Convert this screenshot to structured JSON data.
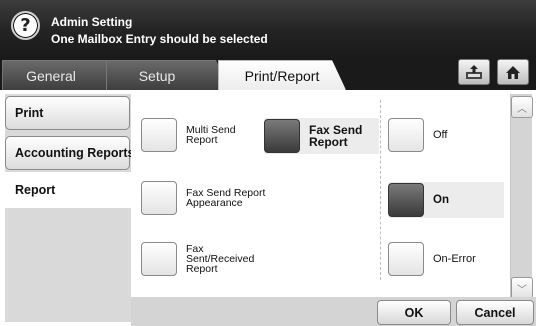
{
  "header": {
    "help_glyph": "?",
    "title": "Admin Setting",
    "message": "One Mailbox Entry should be selected"
  },
  "tabs": [
    {
      "label": "General",
      "active": false
    },
    {
      "label": "Setup",
      "active": false
    },
    {
      "label": "Print/Report",
      "active": true
    }
  ],
  "toolbar": {
    "tray_icon": "tray-upload-icon",
    "home_icon": "home-icon"
  },
  "sidebar": {
    "items": [
      {
        "label": "Print"
      },
      {
        "label": "Accounting Reports"
      },
      {
        "label": "Report",
        "selected": true
      }
    ]
  },
  "report_types": [
    {
      "label": "Multi Send Report",
      "selected": false
    },
    {
      "label": "Fax Send Report Appearance",
      "selected": false
    },
    {
      "label": "Fax Sent/Received Report",
      "selected": false
    },
    {
      "label": "Fax Send Report",
      "selected": true
    }
  ],
  "modes": [
    {
      "label": "Off",
      "selected": false
    },
    {
      "label": "On",
      "selected": true
    },
    {
      "label": "On-Error",
      "selected": false
    }
  ],
  "scroll": {
    "up_glyph": "︿",
    "down_glyph": "﹀"
  },
  "actions": {
    "ok_label": "OK",
    "cancel_label": "Cancel"
  },
  "colors": {
    "selected_fill": "#4a4a4a",
    "header_bg": "#2a2a2a"
  }
}
